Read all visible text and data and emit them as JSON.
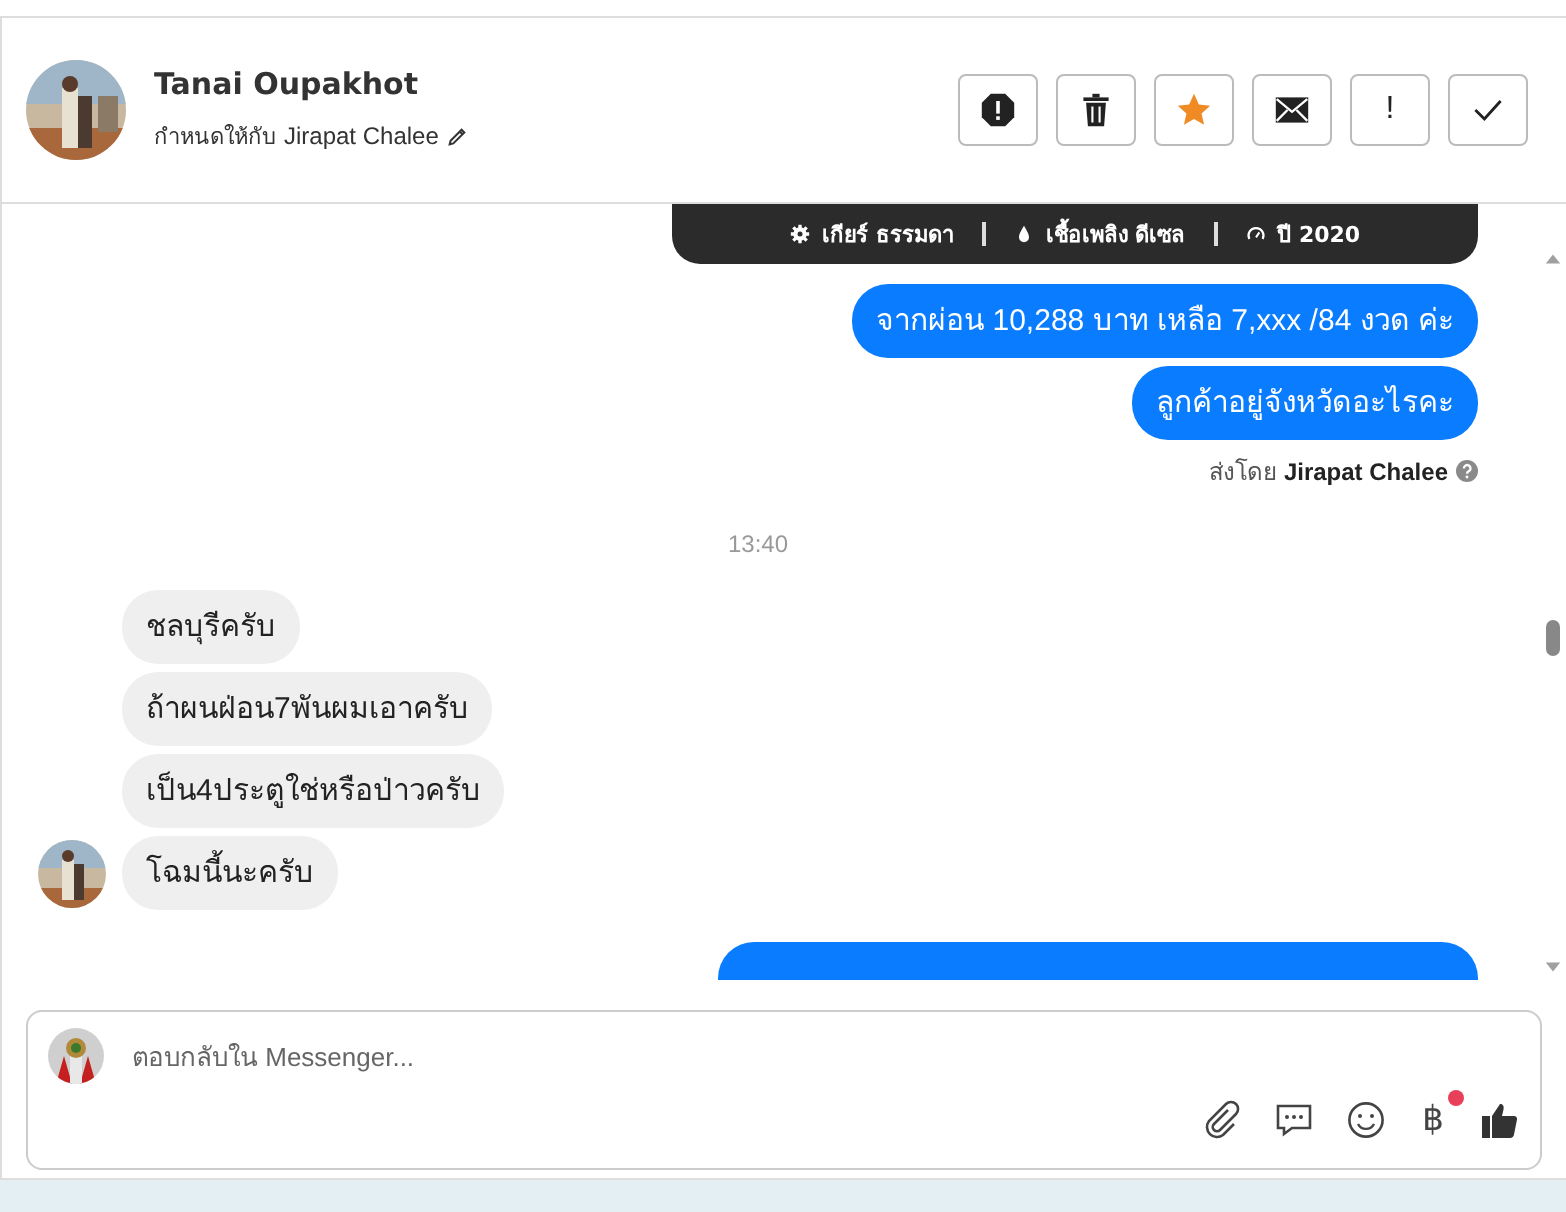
{
  "contact": {
    "name": "Tanai Oupakhot",
    "assigned_label": "กำหนดให้กับ",
    "assignee": "Jirapat Chalee"
  },
  "actions": [
    {
      "kind": "alert",
      "on": false
    },
    {
      "kind": "delete",
      "on": false
    },
    {
      "kind": "star",
      "on": true
    },
    {
      "kind": "mail",
      "on": false
    },
    {
      "kind": "important",
      "label": "!",
      "on": false
    },
    {
      "kind": "done",
      "on": false
    }
  ],
  "car_specs": [
    {
      "kind": "gear",
      "text": "เกียร์ ธรรมดา"
    },
    {
      "kind": "fuel",
      "text": "เชื้อเพลิง ดีเซล"
    },
    {
      "kind": "year",
      "text": "ปี 2020"
    }
  ],
  "messages": [
    {
      "kind": "out",
      "text": "จากผ่อน 10,288 บาท เหลือ 7,xxx /84 งวด ค่ะ"
    },
    {
      "kind": "out",
      "text": "ลูกค้าอยู่จังหวัดอะไรคะ"
    },
    {
      "kind": "sent_by",
      "label": "ส่งโดย",
      "name": "Jirapat Chalee"
    },
    {
      "kind": "time",
      "text": "13:40"
    },
    {
      "kind": "in",
      "text": "ชลบุรีครับ",
      "avatar": false
    },
    {
      "kind": "in",
      "text": "ถ้าผนฝ่อน7พันผมเอาครับ",
      "avatar": false
    },
    {
      "kind": "in",
      "text": "เป็น4ประตูใช่หรือป่าวครับ",
      "avatar": false
    },
    {
      "kind": "in",
      "text": "โฉมนี้นะครับ",
      "avatar": true
    },
    {
      "kind": "out_partial"
    }
  ],
  "composer": {
    "placeholder": "ตอบกลับใน Messenger..."
  },
  "tools": [
    {
      "kind": "attach"
    },
    {
      "kind": "comment"
    },
    {
      "kind": "emoji"
    },
    {
      "kind": "baht",
      "label": "฿",
      "badge": true
    },
    {
      "kind": "like"
    }
  ]
}
